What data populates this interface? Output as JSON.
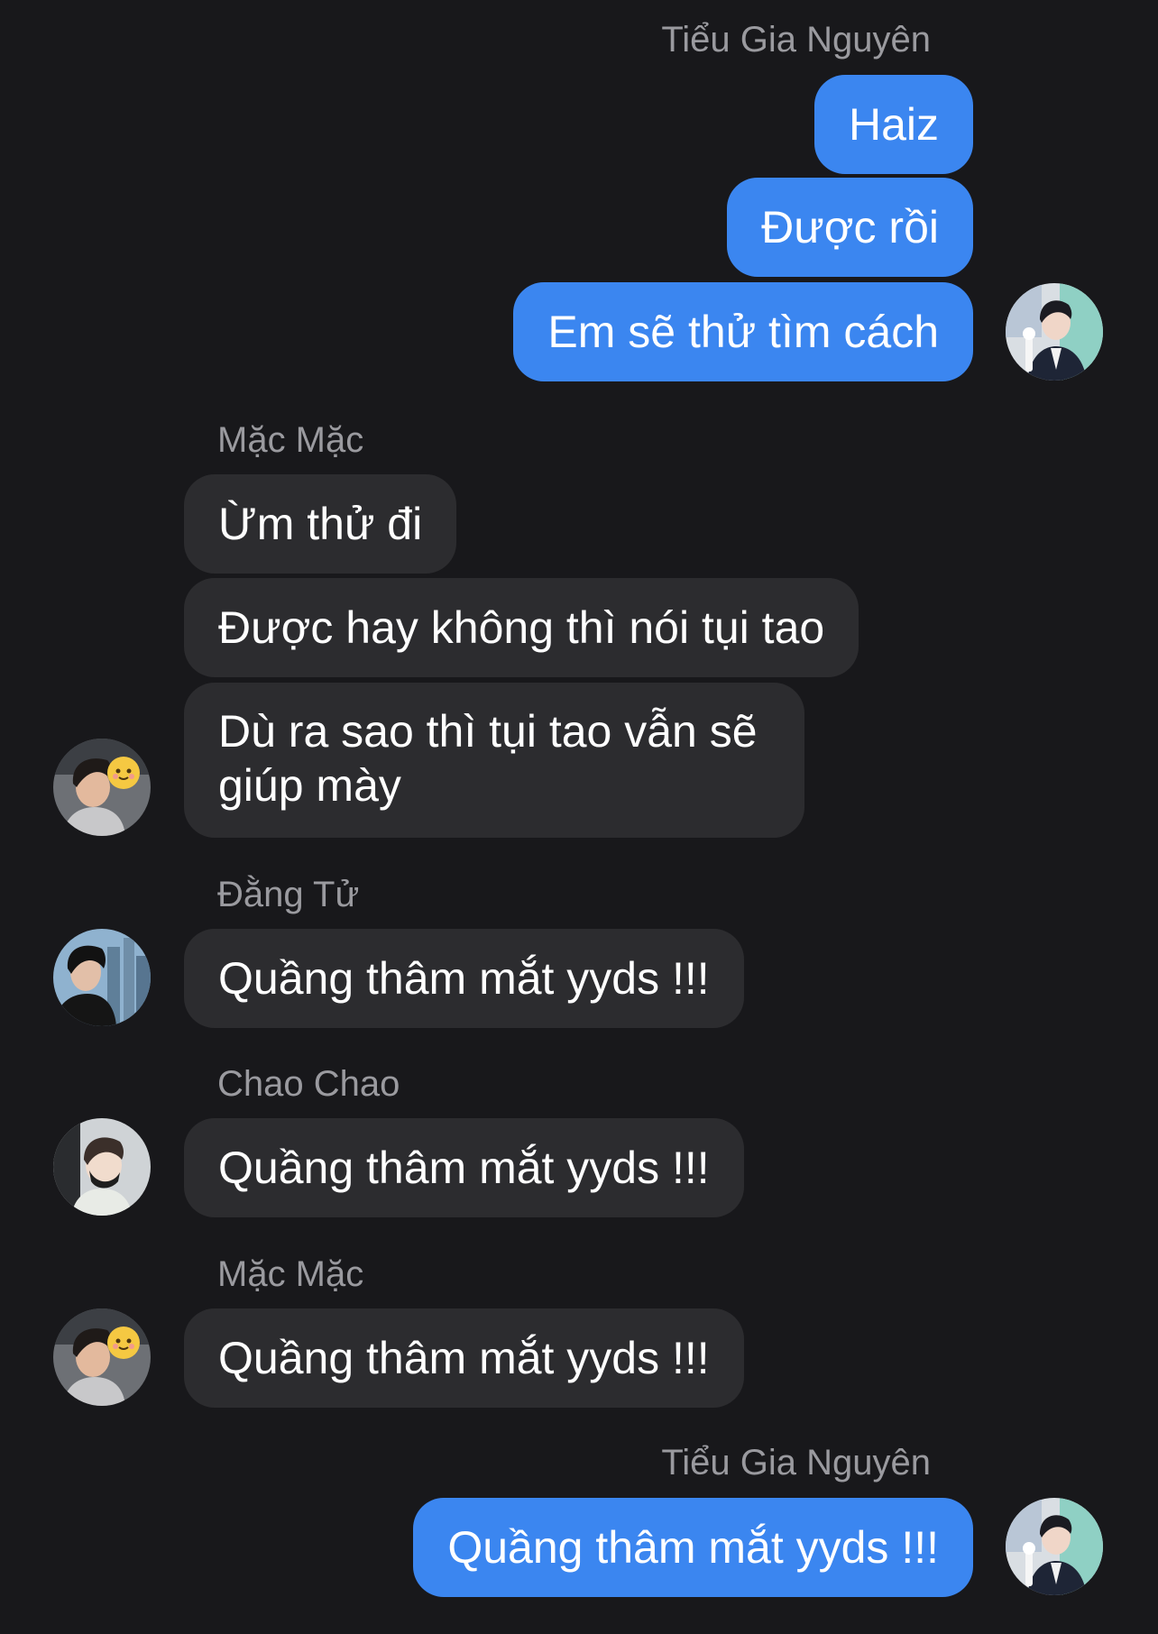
{
  "conversation": {
    "groups": [
      {
        "sender": "Tiểu Gia Nguyên",
        "messages": [
          "Haiz",
          "Được rồi",
          "Em sẽ thử tìm cách"
        ]
      },
      {
        "sender": "Mặc Mặc",
        "messages": [
          "Ừm thử đi",
          "Được hay không thì nói tụi tao",
          "Dù ra sao thì tụi tao vẫn sẽ giúp mày"
        ]
      },
      {
        "sender": "Đằng Tử",
        "messages": [
          "Quầng thâm mắt yyds !!!"
        ]
      },
      {
        "sender": "Chao Chao",
        "messages": [
          "Quầng thâm mắt yyds !!!"
        ]
      },
      {
        "sender": "Mặc Mặc",
        "messages": [
          "Quầng thâm mắt yyds !!!"
        ]
      },
      {
        "sender": "Tiểu Gia Nguyên",
        "messages": [
          "Quầng thâm mắt yyds !!!"
        ]
      }
    ]
  },
  "colors": {
    "background": "#18181b",
    "outgoing_bubble": "#3b86f0",
    "incoming_bubble": "#2c2c2f",
    "sender_name": "#9a9a9f",
    "message_text": "#ffffff"
  }
}
